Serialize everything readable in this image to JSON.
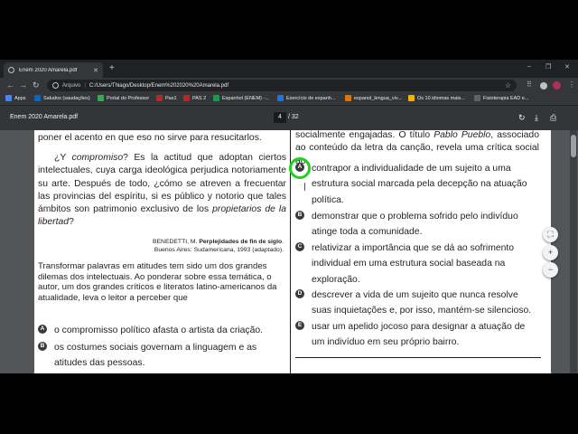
{
  "tab": {
    "title": "Enem 2020 Amarela.pdf",
    "close": "✕",
    "new_tab": "+"
  },
  "window": {
    "minimize": "–",
    "maximize": "❐",
    "close": "✕"
  },
  "omnibox": {
    "scheme": "Arquivo",
    "separator": "|",
    "url": "C:/Users/Thiago/Desktop/Enem%202020%20Amarela.pdf",
    "star": "☆"
  },
  "nav": {
    "back": "←",
    "forward": "→",
    "reload": "↻"
  },
  "toolbar_icons": {
    "extensions": "⠿",
    "menu": "⋮"
  },
  "bookmarks": [
    {
      "label": "Apps",
      "color": "#4285f4"
    },
    {
      "label": "Saludos (saudações)",
      "color": "#0a66c2"
    },
    {
      "label": "Portal do Professor",
      "color": "#34a853"
    },
    {
      "label": "Pas1",
      "color": "#c5221f"
    },
    {
      "label": "PAS 2",
      "color": "#c5221f"
    },
    {
      "label": "Espanhol (ENEM) -...",
      "color": "#0f9d58"
    },
    {
      "label": "Exercício de espanh...",
      "color": "#1a73e8"
    },
    {
      "label": "espanol_lengua_viv...",
      "color": "#e37400"
    },
    {
      "label": "Os 10 idiomas mais...",
      "color": "#f4b400"
    },
    {
      "label": "Fisioterapia EAD e...",
      "color": "#5f6368"
    }
  ],
  "pdf": {
    "title": "Enem 2020 Amarela.pdf",
    "page_current": "4",
    "page_total": "/ 32",
    "icons": {
      "rotate": "↻",
      "download": "⤓",
      "print": "⎙"
    }
  },
  "left_column": {
    "line1": "poner el acento en que eso no sirve para resucitarlos.",
    "para_a": "¿Y ",
    "para_em1": "compromiso",
    "para_b": "? Es la actitud que adoptan ciertos intelectuales, cuya carga ideológica perjudica notoriamente su arte. Después de todo, ¿cómo se atreven a frecuentar las provincias del espíritu, si es público y notorio que tales ámbitos son patrimonio exclusivo de los ",
    "para_em2": "propietarios de la libertad",
    "para_c": "?",
    "source_a": "BENEDETTI, M. ",
    "source_b": "Perplejidades de fin de siglo",
    "source_c": ".",
    "source_line2": "Buenos Aires: Sudamericana, 1993 (adaptado).",
    "question": "Transformar palavras em atitudes tem sido um dos grandes dilemas dos intelectuais. Ao ponderar sobre essa temática, o autor, um dos grandes críticos e literatos latino-americanos da atualidade, leva o leitor a perceber que",
    "options": [
      {
        "letter": "A",
        "text": "o compromisso político afasta o artista da criação."
      },
      {
        "letter": "B",
        "text": "os costumes sociais governam a linguagem e as atitudes das pessoas."
      }
    ]
  },
  "right_column": {
    "intro_a": "socialmente engajadas. O título ",
    "intro_em": "Pablo Pueblo",
    "intro_b": ", associado ao conteúdo da letra da canção, revela uma crítica social ao",
    "options": [
      {
        "letter": "A",
        "text": "contrapor a individualidade de um sujeito a uma estrutura social marcada pela decepção na atuação política."
      },
      {
        "letter": "B",
        "text": "demonstrar que o problema sofrido pelo indivíduo atinge toda a comunidade."
      },
      {
        "letter": "C",
        "text": "relativizar a importância que se dá ao sofrimento individual em uma estrutura social baseada na exploração."
      },
      {
        "letter": "D",
        "text": "descrever a vida de um sujeito que nunca resolve suas inquietações e, por isso, mantém-se silencioso."
      },
      {
        "letter": "E",
        "text": "usar um apelido jocoso para designar a atuação de um indivíduo em seu próprio bairro."
      }
    ]
  },
  "zoom": {
    "fit": "⛶",
    "in": "+",
    "out": "−"
  },
  "colors": {
    "highlight": "#1fd11f",
    "badge": "#3a3a3a"
  }
}
